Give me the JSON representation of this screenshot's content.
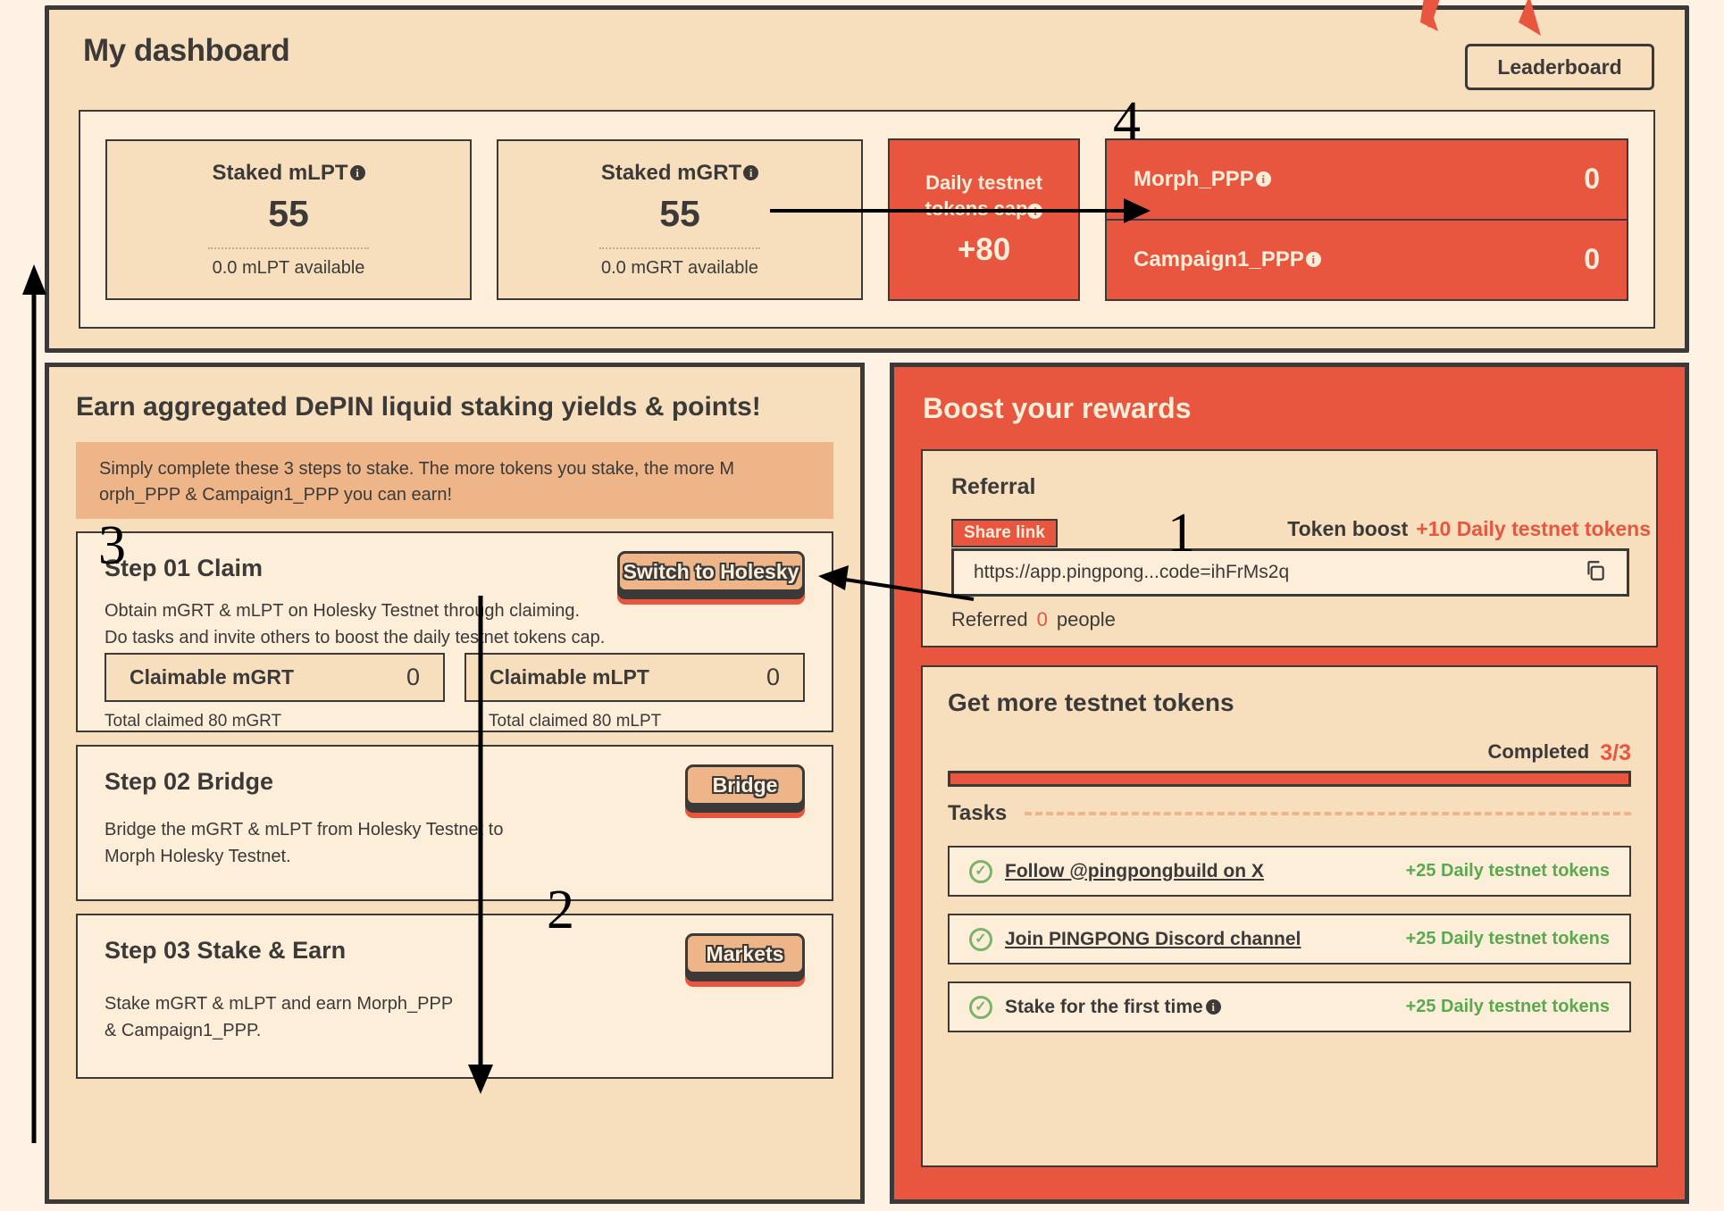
{
  "dashboard": {
    "title": "My dashboard",
    "leaderboard_button": "Leaderboard",
    "stats": [
      {
        "label": "Staked mLPT",
        "value": "55",
        "sub": "0.0 mLPT available"
      },
      {
        "label": "Staked mGRT",
        "value": "55",
        "sub": "0.0 mGRT available"
      }
    ],
    "cap": {
      "label_line1": "Daily testnet",
      "label_line2": "tokens cap",
      "value": "+80"
    },
    "points": [
      {
        "name": "Morph_PPP",
        "value": "0"
      },
      {
        "name": "Campaign1_PPP",
        "value": "0"
      }
    ]
  },
  "earn": {
    "title": "Earn aggregated DePIN liquid staking yields & points!",
    "note_line1": "Simply complete these 3 steps to stake. The more tokens you stake, the more M",
    "note_line2": "orph_PPP & Campaign1_PPP you can earn!",
    "steps": [
      {
        "title": "Step 01 Claim",
        "button": "Switch to Holesky",
        "desc_line1": "Obtain mGRT & mLPT on Holesky Testnet through claiming.",
        "desc_line2": "Do tasks and invite others to boost the daily testnet tokens cap.",
        "claimables": [
          {
            "label": "Claimable mGRT",
            "value": "0",
            "footer": "Total claimed 80 mGRT"
          },
          {
            "label": "Claimable mLPT",
            "value": "0",
            "footer": "Total claimed 80 mLPT"
          }
        ]
      },
      {
        "title": "Step 02 Bridge",
        "button": "Bridge",
        "desc_line1": "Bridge the mGRT & mLPT from Holesky Testnet to",
        "desc_line2": "Morph Holesky Testnet."
      },
      {
        "title": "Step 03 Stake & Earn",
        "button": "Markets",
        "desc_line1": "Stake mGRT & mLPT and earn Morph_PPP",
        "desc_line2": "& Campaign1_PPP."
      }
    ]
  },
  "boost": {
    "title": "Boost your rewards",
    "referral": {
      "title": "Referral",
      "share_tag": "Share link",
      "token_boost_label": "Token boost",
      "token_boost_amount": "+10 Daily testnet tokens",
      "link": "https://app.pingpong...code=ihFrMs2q",
      "copy_icon": "copy-icon",
      "referred_prefix": "Referred",
      "referred_count": "0",
      "referred_suffix": "people"
    },
    "tokens": {
      "title": "Get more testnet tokens",
      "completed_label": "Completed",
      "completed_value": "3/3",
      "progress_percent": 100,
      "tasks_label": "Tasks",
      "tasks": [
        {
          "label": "Follow @pingpongbuild on X",
          "reward": "+25 Daily testnet tokens",
          "done": true,
          "link": true,
          "info": false
        },
        {
          "label": "Join PINGPONG Discord channel",
          "reward": "+25 Daily testnet tokens",
          "done": true,
          "link": true,
          "info": false
        },
        {
          "label": "Stake for the first time",
          "reward": "+25 Daily testnet tokens",
          "done": true,
          "link": false,
          "info": true
        }
      ]
    }
  },
  "annotations": {
    "numbers": [
      "1",
      "2",
      "3",
      "4"
    ]
  },
  "colors": {
    "accent_red": "#e8563f",
    "card_tan": "#f7dfbd",
    "panel_cream": "#fdeed9",
    "page_bg": "#fdf2e3",
    "ink": "#3b3a38",
    "green": "#5aa84f"
  }
}
